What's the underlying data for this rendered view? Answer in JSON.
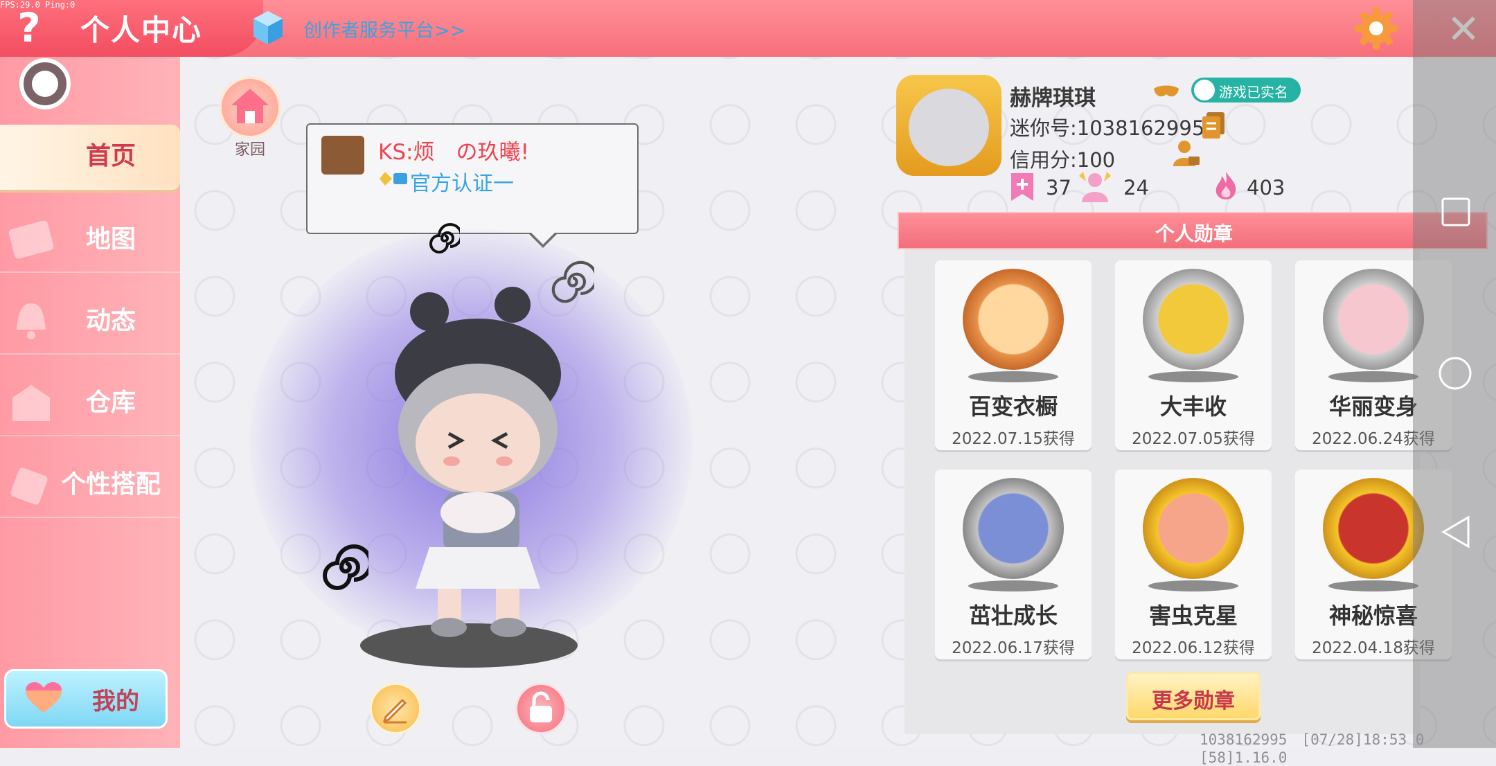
{
  "header": {
    "debug": "FPS:29.0 Ping:0",
    "title": "个人中心",
    "creator_link": "创作者服务平台>>",
    "help_symbol": "?",
    "close_symbol": "✕"
  },
  "sidebar": {
    "items": [
      {
        "label": "首页",
        "icon": "home-tab-icon",
        "active": true
      },
      {
        "label": "地图",
        "icon": "map-icon",
        "active": false
      },
      {
        "label": "动态",
        "icon": "bell-icon",
        "active": false
      },
      {
        "label": "仓库",
        "icon": "warehouse-icon",
        "active": false
      },
      {
        "label": "个性搭配",
        "icon": "outfit-icon",
        "active": false
      }
    ],
    "mine_label": "我的"
  },
  "home": {
    "label": "家园"
  },
  "bubble": {
    "name": "KS:烦　の玖曦!",
    "certification": "官方认证一"
  },
  "profile": {
    "nickname": "赫牌琪琪",
    "verified_label": "游戏已实名",
    "mini_id": "迷你号:1038162995",
    "credit": "信用分:100",
    "stats": [
      {
        "icon": "bookmark-plus-icon",
        "value": "37",
        "color": "#f17ab7"
      },
      {
        "icon": "fans-icon",
        "value": "24",
        "color": "#f5a0c8"
      },
      {
        "icon": "flame-icon",
        "value": "403",
        "color": "#f06aa6"
      }
    ]
  },
  "medals": {
    "title": "个人勋章",
    "items": [
      {
        "name": "百变衣橱",
        "date": "2022.07.15获得",
        "ring": "#e8924a"
      },
      {
        "name": "大丰收",
        "date": "2022.07.05获得",
        "ring": "#c9c9c9"
      },
      {
        "name": "华丽变身",
        "date": "2022.06.24获得",
        "ring": "#c9c9c9"
      },
      {
        "name": "茁壮成长",
        "date": "2022.06.17获得",
        "ring": "#bdbdbd"
      },
      {
        "name": "害虫克星",
        "date": "2022.06.12获得",
        "ring": "#f1b81f"
      },
      {
        "name": "神秘惊喜",
        "date": "2022.04.18获得",
        "ring": "#f1b81f"
      }
    ],
    "more_label": "更多勋章"
  },
  "footer": {
    "info": "1038162995　[07/28]18:53 0　[58]1.16.0"
  }
}
